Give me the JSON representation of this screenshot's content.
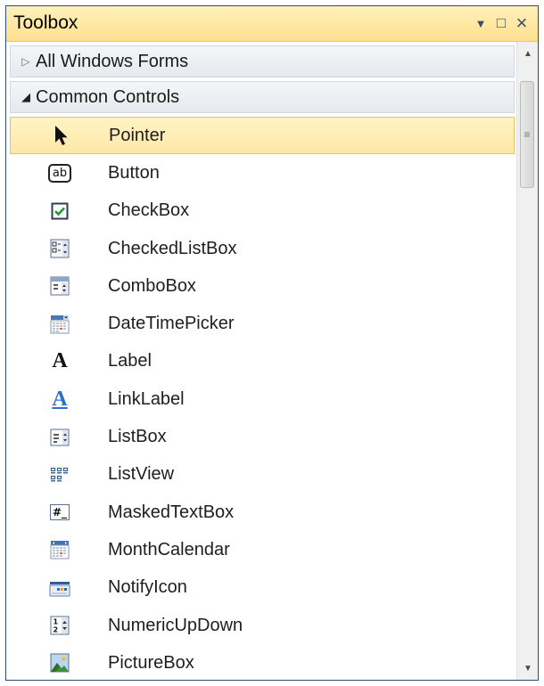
{
  "window": {
    "title": "Toolbox",
    "dropdown_glyph": "▼",
    "maximize_glyph": "□",
    "close_glyph": "×"
  },
  "categories": [
    {
      "label": "All Windows Forms",
      "expanded": false,
      "arrow": "▷"
    },
    {
      "label": "Common Controls",
      "expanded": true,
      "arrow": "◢"
    }
  ],
  "items": [
    {
      "label": "Pointer",
      "icon": "pointer-icon",
      "selected": true
    },
    {
      "label": "Button",
      "icon": "button-icon"
    },
    {
      "label": "CheckBox",
      "icon": "checkbox-icon"
    },
    {
      "label": "CheckedListBox",
      "icon": "checkedlistbox-icon"
    },
    {
      "label": "ComboBox",
      "icon": "combobox-icon"
    },
    {
      "label": "DateTimePicker",
      "icon": "datetimepicker-icon"
    },
    {
      "label": "Label",
      "icon": "label-icon"
    },
    {
      "label": "LinkLabel",
      "icon": "linklabel-icon"
    },
    {
      "label": "ListBox",
      "icon": "listbox-icon"
    },
    {
      "label": "ListView",
      "icon": "listview-icon"
    },
    {
      "label": "MaskedTextBox",
      "icon": "maskedtextbox-icon"
    },
    {
      "label": "MonthCalendar",
      "icon": "monthcalendar-icon"
    },
    {
      "label": "NotifyIcon",
      "icon": "notifyicon-icon"
    },
    {
      "label": "NumericUpDown",
      "icon": "numericupdown-icon"
    },
    {
      "label": "PictureBox",
      "icon": "picturebox-icon"
    }
  ],
  "icon_text": {
    "button": "ab",
    "label": "A",
    "maskedtextbox": "#_",
    "numericupdown": "1 2"
  },
  "colors": {
    "titlebar": "#ffe9a8",
    "selection": "#ffefb9",
    "accent": "#2a6fc9"
  },
  "scrollbar": {
    "up_glyph": "▲",
    "down_glyph": "▼",
    "grip_glyph": "≡"
  }
}
